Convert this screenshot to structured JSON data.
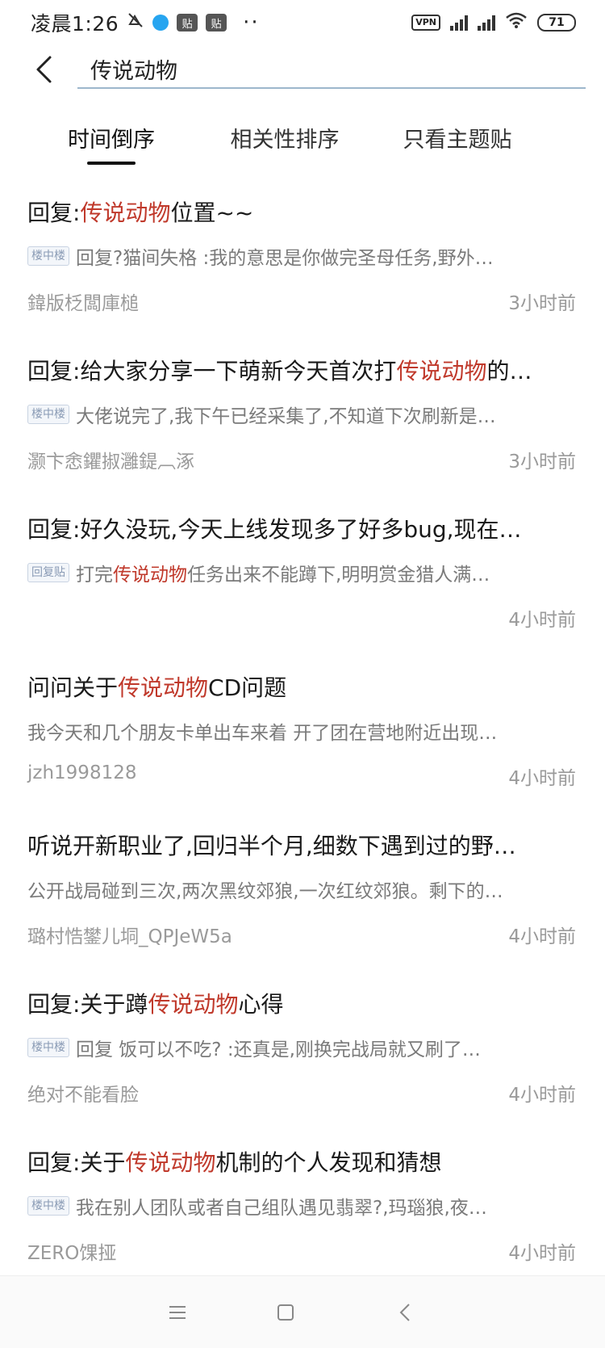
{
  "status_bar": {
    "time": "凌晨1:26",
    "battery": "71",
    "vpn_label": "VPN",
    "badge1": "贴",
    "badge2": "贴",
    "more": "··"
  },
  "search": {
    "query": "传说动物"
  },
  "tabs": [
    {
      "label": "时间倒序",
      "active": true
    },
    {
      "label": "相关性排序",
      "active": false
    },
    {
      "label": "只看主题贴",
      "active": false
    }
  ],
  "results": [
    {
      "title_pre": "回复:",
      "title_hl": "传说动物",
      "title_post": "位置~~",
      "tag": "楼中楼",
      "snippet_pre": "回复?猫间失格 :我的意思是你做完圣母任务,野外…",
      "snippet_hl": "",
      "snippet_post": "",
      "user": "鍏版柉闆庫槌",
      "time": "3小时前"
    },
    {
      "title_pre": "回复:给大家分享一下萌新今天首次打",
      "title_hl": "传说动物",
      "title_post": "的…",
      "tag": "楼中楼",
      "snippet_pre": "大佬说完了,我下午已经采集了,不知道下次刷新是…",
      "snippet_hl": "",
      "snippet_post": "",
      "user": "灏卞悆鑺掓灉鍉︹涿",
      "time": "3小时前"
    },
    {
      "title_pre": "回复:好久没玩,今天上线发现多了好多bug,现在…",
      "title_hl": "",
      "title_post": "",
      "tag": "回复贴",
      "snippet_pre": "打完",
      "snippet_hl": "传说动物",
      "snippet_post": "任务出来不能蹲下,明明赏金猎人满…",
      "user": "",
      "time": "4小时前"
    },
    {
      "title_pre": "问问关于",
      "title_hl": "传说动物",
      "title_post": "CD问题",
      "tag": "",
      "snippet_pre": "我今天和几个朋友卡单出车来着 开了团在营地附近出现…",
      "snippet_hl": "",
      "snippet_post": "",
      "user": "jzh1998128",
      "time": "4小时前"
    },
    {
      "title_pre": "听说开新职业了,回归半个月,细数下遇到过的野…",
      "title_hl": "",
      "title_post": "",
      "tag": "",
      "snippet_pre": "公开战局碰到三次,两次黑纹郊狼,一次红纹郊狼。剩下的…",
      "snippet_hl": "",
      "snippet_post": "",
      "user": "璐村悎鐢儿垌_QPJeW5a",
      "time": "4小时前"
    },
    {
      "title_pre": "回复:关于蹲",
      "title_hl": "传说动物",
      "title_post": "心得",
      "tag": "楼中楼",
      "snippet_pre": "回复 饭可以不吃? :还真是,刚换完战局就又刷了…",
      "snippet_hl": "",
      "snippet_post": "",
      "user": "绝对不能看脸",
      "time": "4小时前"
    },
    {
      "title_pre": "回复:关于",
      "title_hl": "传说动物",
      "title_post": "机制的个人发现和猜想",
      "tag": "楼中楼",
      "snippet_pre": "我在别人团队或者自己组队遇见翡翠?,玛瑙狼,夜…",
      "snippet_hl": "",
      "snippet_post": "",
      "user": "ZERO馃挜",
      "time": "4小时前"
    }
  ],
  "colors": {
    "highlight": "#c0392b",
    "meta_text": "#9a9a9a",
    "search_underline": "#9db7cc"
  }
}
